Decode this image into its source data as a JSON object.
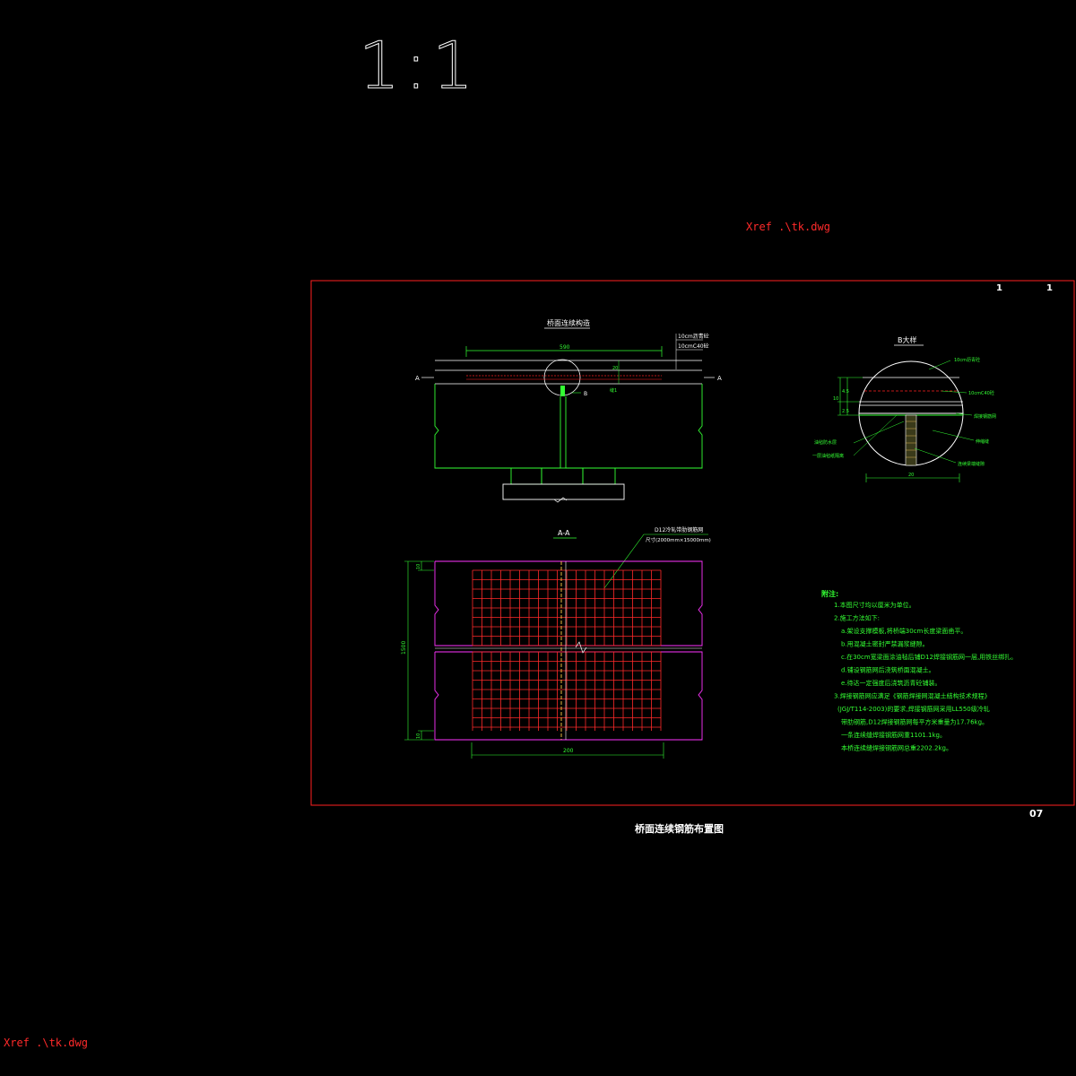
{
  "header": {
    "scale_text": "1:1",
    "xref_top": "Xref .\\tk.dwg",
    "xref_bottom": "Xref .\\tk.dwg"
  },
  "sheet": {
    "corner_a": "1",
    "corner_b": "1",
    "page_number": "07",
    "drawing_title": "桥面连续钢筋布置图"
  },
  "elevation": {
    "title": "桥面连续构造",
    "dim_width": "590",
    "label_asphalt": "10cm沥青砼",
    "label_concrete": "10cmC40砼",
    "section_left": "A",
    "section_right": "A",
    "detail_mark": "B",
    "small_label": "缝1",
    "dim_small": "20"
  },
  "detail_b": {
    "title": "B大样",
    "label_asphalt": "10cm沥青砼",
    "label_concrete": "10cmC40砼",
    "label_mesh": "焊接钢筋网",
    "label_joint": "伸缩缝",
    "label_left1": "油毡防水层",
    "label_left2": "一层油毡纸隔离",
    "label_right_bottom": "连续梁端缝隙",
    "dim_height": "10",
    "dim_a": "4.5",
    "dim_b": "2.5",
    "dim_width": "20"
  },
  "section_aa": {
    "title": "A-A",
    "mesh_label": "D12冷轧带肋钢筋网",
    "mesh_size": "尺寸(2000mm×15000mm)",
    "dim_height": "1500",
    "dim_top": "10",
    "dim_bottom": "10",
    "dim_width": "200"
  },
  "notes": {
    "heading": "附注:",
    "lines": [
      "1.本图尺寸均以厘米为单位。",
      "2.施工方法如下:",
      "a.架设支撑模板,将桥端30cm长度梁面凿平。",
      "b.用混凝土密封严禁漏浆缝隙。",
      "c.在30cm宽梁面涂油毡后铺D12焊接钢筋网一层,用铁丝绑扎。",
      "d.铺设钢筋网后浇筑桥面混凝土。",
      "e.待达一定强度后浇筑沥青砼铺装。",
      "3.焊接钢筋网应满足《钢筋焊接网混凝土结构技术规程》",
      "(JGJ/T114-2003)的要求,焊接钢筋网采用LL550级冷轧",
      "带肋钢筋,D12焊接钢筋网每平方米重量为17.76kg。",
      "一条连续缝焊接钢筋网重1101.1kg。",
      "本桥连续缝焊接钢筋网总重2202.2kg。"
    ]
  }
}
